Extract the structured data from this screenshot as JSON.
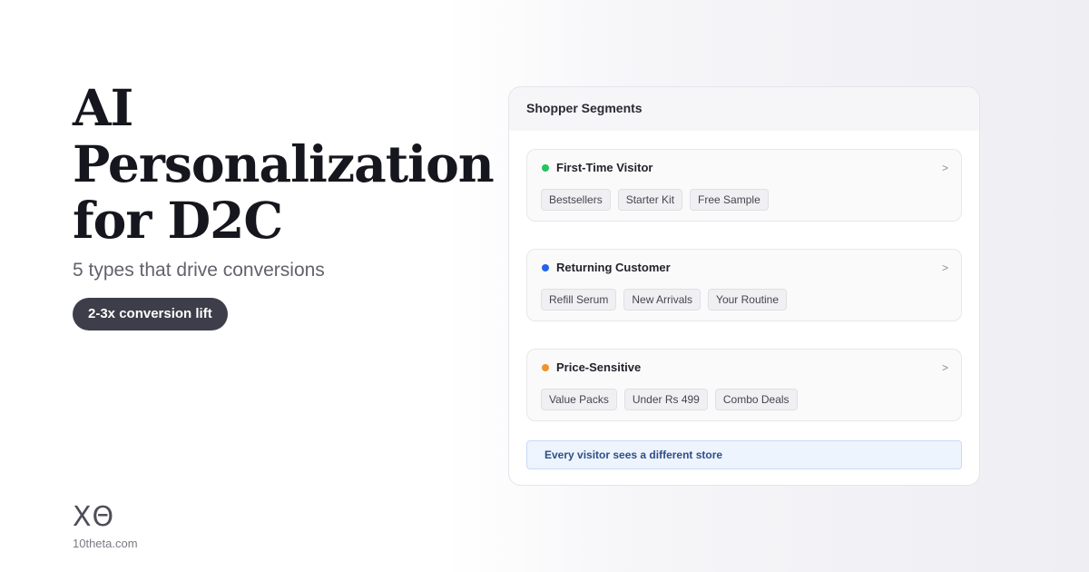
{
  "hero": {
    "title_lines": [
      "AI",
      "Personalization",
      "for D2C"
    ],
    "subtitle": "5 types that drive conversions",
    "pill": "2-3x conversion lift"
  },
  "brand": {
    "logo": "XΘ",
    "url": "10theta.com"
  },
  "card": {
    "title": "Shopper Segments",
    "segments": [
      {
        "name": "First-Time Visitor",
        "dot_color": "#22c55e",
        "chevron": ">",
        "tags": [
          "Bestsellers",
          "Starter Kit",
          "Free Sample"
        ]
      },
      {
        "name": "Returning Customer",
        "dot_color": "#2563eb",
        "chevron": ">",
        "tags": [
          "Refill Serum",
          "New Arrivals",
          "Your Routine"
        ]
      },
      {
        "name": "Price-Sensitive",
        "dot_color": "#f0932b",
        "chevron": ">",
        "tags": [
          "Value Packs",
          "Under Rs 499",
          "Combo Deals"
        ]
      }
    ],
    "footer": "Every visitor sees a different store"
  }
}
